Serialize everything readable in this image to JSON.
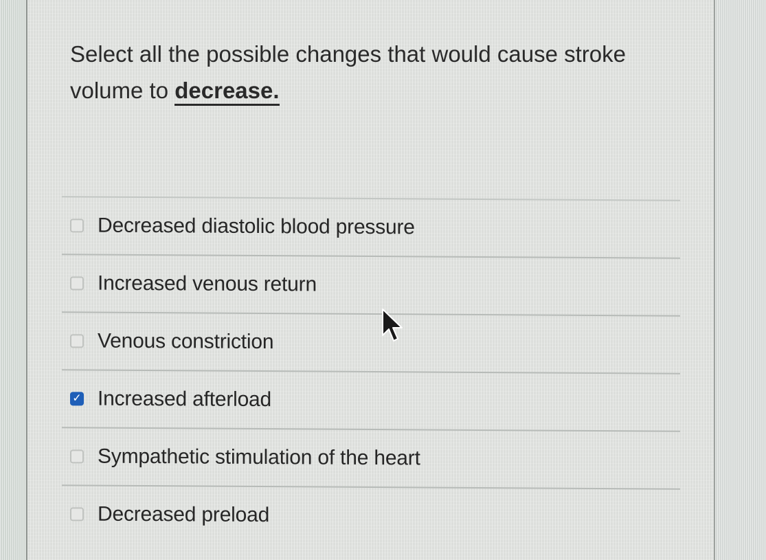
{
  "question": {
    "prefix": "Select all the possible changes that would cause stroke volume to ",
    "emphasis": "decrease."
  },
  "options": [
    {
      "label": "Decreased diastolic blood pressure",
      "checked": false
    },
    {
      "label": "Increased venous return",
      "checked": false
    },
    {
      "label": "Venous constriction",
      "checked": false
    },
    {
      "label": "Increased afterload",
      "checked": true
    },
    {
      "label": "Sympathetic stimulation of the heart",
      "checked": false
    },
    {
      "label": "Decreased preload",
      "checked": false
    }
  ],
  "colors": {
    "checked_box": "#1f5fb8",
    "text": "#2a2a2a"
  }
}
